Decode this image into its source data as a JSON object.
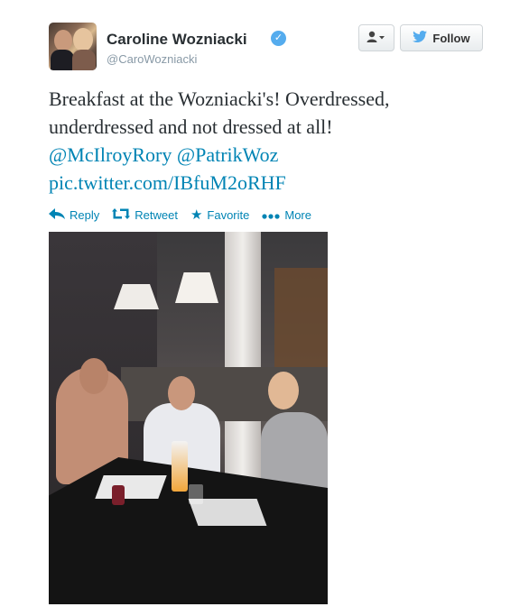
{
  "user": {
    "name": "Caroline Wozniacki",
    "handle": "@CaroWozniacki",
    "verified_icon": "verified-badge-icon",
    "verified_color": "#55acee"
  },
  "buttons": {
    "user_actions_icon": "person-dropdown-icon",
    "follow_label": "Follow",
    "follow_icon": "twitter-bird-icon"
  },
  "tweet": {
    "line1": "Breakfast at the Wozniacki's! Overdressed,",
    "line2": "underdressed and not dressed at all!",
    "mention1": "@McIlroyRory",
    "mention2": "@PatrikWoz",
    "pic_link": "pic.twitter.com/IBfuM2oRHF"
  },
  "actions": [
    {
      "label": "Reply",
      "icon": "reply-icon"
    },
    {
      "label": "Retweet",
      "icon": "retweet-icon"
    },
    {
      "label": "Favorite",
      "icon": "star-icon"
    },
    {
      "label": "More",
      "icon": "more-dots-icon"
    }
  ],
  "colors": {
    "link": "#0084b4",
    "text": "#292f33",
    "muted": "#8899a6"
  }
}
